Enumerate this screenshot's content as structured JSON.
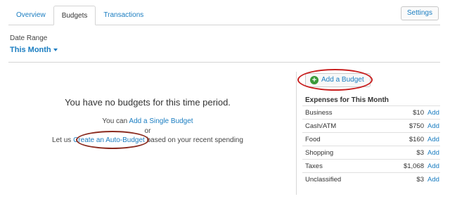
{
  "tabs": [
    {
      "label": "Overview",
      "active": false
    },
    {
      "label": "Budgets",
      "active": true
    },
    {
      "label": "Transactions",
      "active": false
    }
  ],
  "settings_label": "Settings",
  "date_range": {
    "label": "Date Range",
    "value": "This Month"
  },
  "empty_state": {
    "title": "You have no budgets for this time period.",
    "line1_prefix": "You can ",
    "line1_link": "Add a Single Budget",
    "line2": "or",
    "line3_prefix": "Let us ",
    "line3_link": "Create an Auto-Budget",
    "line3_suffix": " based on your recent spending"
  },
  "add_budget_label": "Add a Budget",
  "expenses": {
    "title": "Expenses for This Month",
    "add_label": "Add",
    "rows": [
      {
        "name": "Business",
        "amount": "$10"
      },
      {
        "name": "Cash/ATM",
        "amount": "$750"
      },
      {
        "name": "Food",
        "amount": "$160"
      },
      {
        "name": "Shopping",
        "amount": "$3"
      },
      {
        "name": "Taxes",
        "amount": "$1,068"
      },
      {
        "name": "Unclassified",
        "amount": "$3"
      }
    ]
  },
  "colors": {
    "link": "#1a7dc1",
    "annotation": "#c81e1e",
    "plus_icon": "#3a9a3a"
  }
}
